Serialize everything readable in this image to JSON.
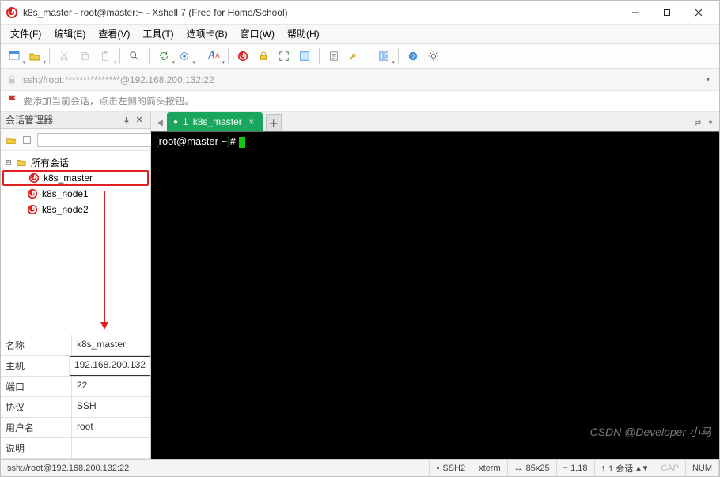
{
  "window": {
    "title": "k8s_master - root@master:~ - Xshell 7 (Free for Home/School)"
  },
  "menu": {
    "file": "文件(F)",
    "edit": "编辑(E)",
    "view": "查看(V)",
    "tools": "工具(T)",
    "tabs": "选项卡(B)",
    "window": "窗口(W)",
    "help": "帮助(H)"
  },
  "addressbar": {
    "text": "ssh://root:***************@192.168.200.132:22"
  },
  "hint": {
    "text": "要添加当前会话，点击左侧的箭头按钮。"
  },
  "sidebar": {
    "title": "会话管理器",
    "root": "所有会话",
    "items": [
      {
        "label": "k8s_master",
        "selected": true
      },
      {
        "label": "k8s_node1",
        "selected": false
      },
      {
        "label": "k8s_node2",
        "selected": false
      }
    ]
  },
  "properties": {
    "name_k": "名称",
    "name_v": "k8s_master",
    "host_k": "主机",
    "host_v": "192.168.200.132",
    "port_k": "端口",
    "port_v": "22",
    "proto_k": "协议",
    "proto_v": "SSH",
    "user_k": "用户名",
    "user_v": "root",
    "desc_k": "说明",
    "desc_v": ""
  },
  "tab": {
    "index": "1",
    "label": "k8s_master"
  },
  "terminal": {
    "prompt_user": "root@master",
    "prompt_path": "~",
    "prompt_suffix": "#"
  },
  "status": {
    "conn": "ssh://root@192.168.200.132:22",
    "proto": "SSH2",
    "term": "xterm",
    "size": "85x25",
    "pos": "1,18",
    "sess": "1 会话",
    "cap": "CAP",
    "num": "NUM"
  },
  "icons": {
    "xshell": "xshell-icon"
  },
  "watermark": "CSDN @Developer 小马"
}
